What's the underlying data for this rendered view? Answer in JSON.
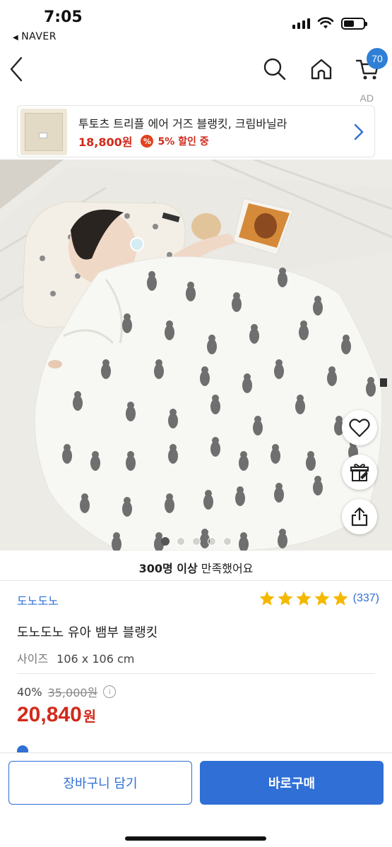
{
  "status": {
    "time": "7:05",
    "back_app": "NAVER"
  },
  "nav": {
    "cart_count": "70",
    "icons": [
      "back-chevron-icon",
      "search-icon",
      "home-icon",
      "cart-icon"
    ]
  },
  "ad": {
    "label": "AD",
    "title": "투토츠 트리플 에어 거즈 블랭킷, 크림바닐라",
    "price": "18,800원",
    "discount_icon": "%",
    "discount_text": "5% 할인 중"
  },
  "gallery": {
    "total_images": 5,
    "active_index": 0
  },
  "satisfaction": {
    "bold": "300명 이상",
    "rest": " 만족했어요"
  },
  "product": {
    "brand": "도노도노",
    "rating": 5,
    "review_count": "(337)",
    "name": "도노도노 유아 뱀부 블랭킷",
    "size_label": "사이즈",
    "size_value": "106 x 106 cm",
    "discount_rate": "40%",
    "original_price": "35,000원",
    "info_icon": "i",
    "price": "20,840",
    "currency": "원"
  },
  "bottom": {
    "cart_button": "장바구니 담기",
    "buy_button": "바로구매"
  },
  "colors": {
    "accent": "#2f6fd6",
    "price_red": "#d12a1c",
    "star": "#f5b800"
  }
}
